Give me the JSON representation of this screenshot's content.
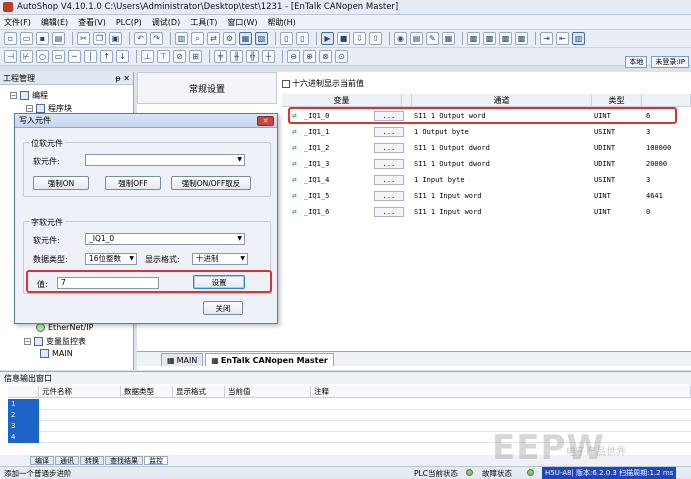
{
  "window": {
    "title": "AutoShop V4.10.1.0  C:\\Users\\Administrator\\Desktop\\test\\1231 - [EnTalk CANopen Master]"
  },
  "menu": [
    "文件(F)",
    "编辑(E)",
    "查看(V)",
    "PLC(P)",
    "调试(D)",
    "工具(T)",
    "窗口(W)",
    "帮助(H)"
  ],
  "toolbar_right": {
    "local_label": "本地",
    "login_label": "未登录:IP"
  },
  "project_panel": {
    "title": "工程管理",
    "pin": "ᵽ",
    "close": "✕",
    "tree": {
      "root_label": "编程",
      "program_block": "程序块",
      "ethernet": "EtherNet/IP",
      "var_monitor": "变量监控表",
      "main": "MAIN"
    }
  },
  "settings_header": "常规设置",
  "hex_checkbox_label": "十六进制显示当前值",
  "grid": {
    "headers": [
      "变量",
      "",
      "通道",
      "类型",
      ""
    ],
    "rows": [
      {
        "var": "_IQ1_0",
        "dots": "...",
        "channel": "SI1 1 Output word",
        "type": "UINT",
        "value": "6"
      },
      {
        "var": "_IQ1_1",
        "dots": "...",
        "channel": "1 Output byte",
        "type": "USINT",
        "value": "3"
      },
      {
        "var": "_IQ1_2",
        "dots": "...",
        "channel": "SI1 1 Output dword",
        "type": "UDINT",
        "value": "100000"
      },
      {
        "var": "_IQ1_3",
        "dots": "...",
        "channel": "SI1 1 Output dword",
        "type": "UDINT",
        "value": "20000"
      },
      {
        "var": "_IQ1_4",
        "dots": "...",
        "channel": "1 Input byte",
        "type": "USINT",
        "value": "3"
      },
      {
        "var": "_IQ1_5",
        "dots": "...",
        "channel": "SI1 1 Input word",
        "type": "UINT",
        "value": "4641"
      },
      {
        "var": "_IQ1_6",
        "dots": "...",
        "channel": "SI1 1 Input word",
        "type": "UINT",
        "value": "0"
      }
    ]
  },
  "dialog": {
    "title": "写入元件",
    "close": "✕",
    "bit_group": {
      "label": "位软元件",
      "element_label": "软元件:",
      "element_value": "",
      "btn_on": "强制ON",
      "btn_off": "强制OFF",
      "btn_toggle": "强制ON/OFF取反"
    },
    "word_group": {
      "label": "字软元件",
      "element_label": "软元件:",
      "element_value": "_IQ1_0",
      "datatype_label": "数据类型:",
      "datatype_value": "16位整数",
      "format_label": "显示格式:",
      "format_value": "十进制",
      "value_label": "值:",
      "value_value": "7",
      "set_btn": "设置"
    },
    "close_btn": "关闭"
  },
  "doc_tabs": [
    "MAIN",
    "EnTalk CANopen Master"
  ],
  "output": {
    "title": "信息输出窗口",
    "headers": [
      "元件名称",
      "数据类型",
      "显示格式",
      "当前值",
      "注释"
    ],
    "rows": [
      "1",
      "2",
      "3",
      "4"
    ]
  },
  "bottom_tabs": [
    "编译",
    "通讯",
    "转换",
    "查找结果",
    "监控"
  ],
  "status": {
    "left": "添加一个普通步进阶",
    "plc_status": "PLC当前状态",
    "fault_status": "故障状态",
    "plc_info": "H5U-A8| 版本:6.2.0.3 扫描周期:1.2 ms"
  },
  "watermark": {
    "main": "EEPW",
    "sub": "电子产品世界"
  }
}
